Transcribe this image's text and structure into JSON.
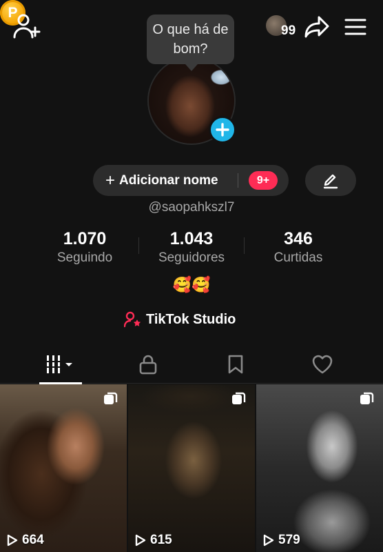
{
  "header": {
    "coin_letter": "P",
    "visitors_count": "99",
    "tooltip": "O que há de bom?"
  },
  "profile": {
    "add_name_label": "Adicionar nome",
    "add_name_plus": "+",
    "notification_badge": "9+",
    "username": "@saopahkszl7",
    "stats": [
      {
        "value": "1.070",
        "label": "Seguindo"
      },
      {
        "value": "1.043",
        "label": "Seguidores"
      },
      {
        "value": "346",
        "label": "Curtidas"
      }
    ],
    "bio": "🥰🥰",
    "studio_label": "TikTok Studio"
  },
  "tabs": [
    {
      "icon": "grid-icon",
      "active": true
    },
    {
      "icon": "lock-icon",
      "active": false
    },
    {
      "icon": "bookmark-icon",
      "active": false
    },
    {
      "icon": "heart-icon",
      "active": false
    }
  ],
  "videos": [
    {
      "views": "664"
    },
    {
      "views": "615"
    },
    {
      "views": "579"
    }
  ],
  "colors": {
    "background": "#121212",
    "accent_red": "#fe2c55",
    "accent_blue": "#20b6e8",
    "coin": "#f5a300"
  }
}
